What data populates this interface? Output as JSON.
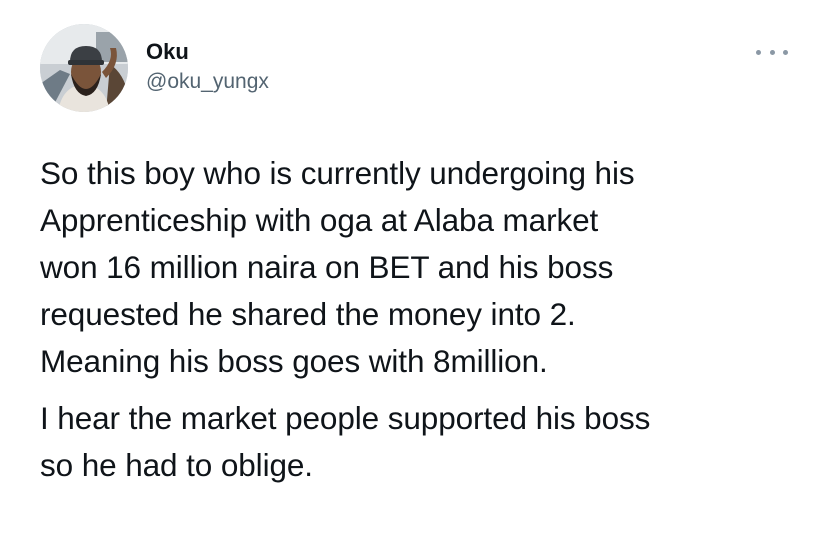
{
  "author": {
    "display_name": "Oku",
    "handle": "@oku_yungx",
    "avatar_icon": "profile-photo"
  },
  "menu": {
    "icon": "more-options-icon"
  },
  "tweet": {
    "paragraph1_lines": [
      "So this boy who is currently undergoing his",
      "Apprenticeship with oga at Alaba market",
      "won 16 million naira on BET and his boss",
      "requested he shared the money into 2.",
      "Meaning his boss goes with 8million."
    ],
    "paragraph2_lines": [
      "I hear the market people supported his boss",
      "so he had to oblige."
    ]
  },
  "colors": {
    "text": "#0f1419",
    "handle": "#536471",
    "menu_dots": "#8b98a5"
  }
}
